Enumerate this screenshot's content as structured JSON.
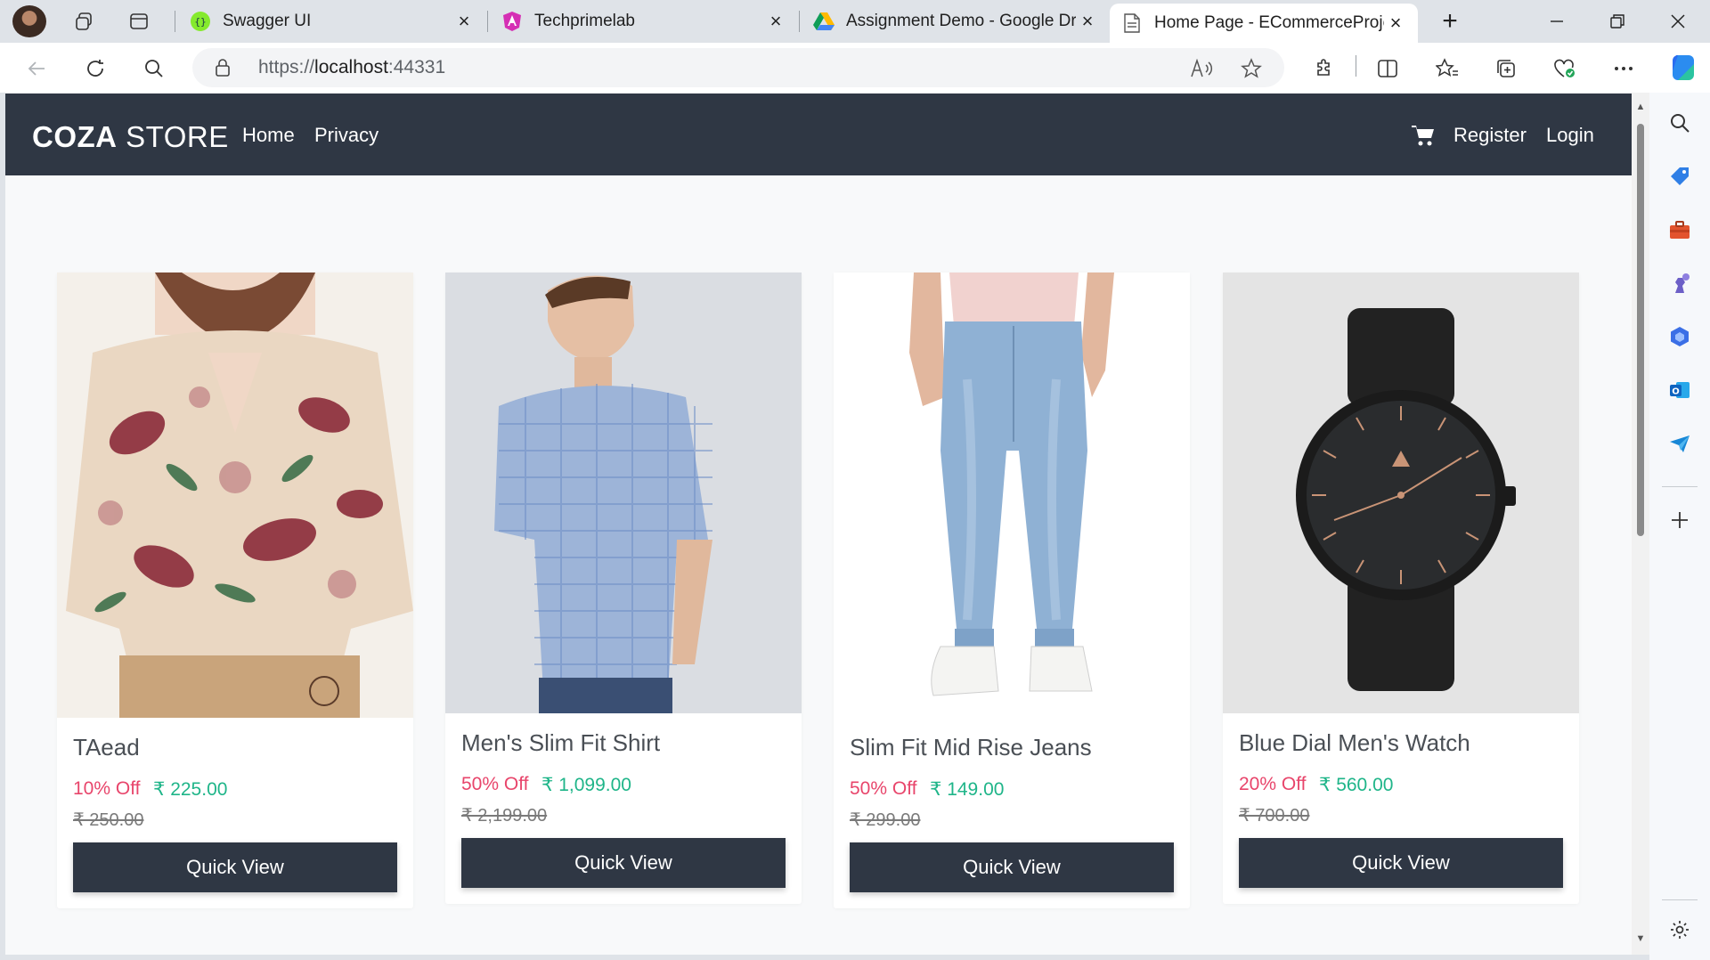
{
  "browser": {
    "tabs": [
      {
        "title": "Swagger UI",
        "icon": "swagger-icon"
      },
      {
        "title": "Techprimelab",
        "icon": "angular-icon"
      },
      {
        "title": "Assignment Demo - Google Dri",
        "icon": "google-drive-icon"
      },
      {
        "title": "Home Page - ECommerceProjec",
        "icon": "page-icon",
        "active": true
      }
    ],
    "close_glyph": "×",
    "new_tab_glyph": "+",
    "address": {
      "scheme": "https://",
      "host": "localhost",
      "port": ":44331"
    },
    "sidebar_icons": [
      "search-icon",
      "tag-icon",
      "toolbox-icon",
      "games-icon",
      "copilot-hex-icon",
      "outlook-icon",
      "send-icon",
      "add-icon",
      "settings-icon"
    ]
  },
  "site": {
    "brand_bold": "COZA",
    "brand_rest": " STORE",
    "nav": {
      "home": "Home",
      "privacy": "Privacy",
      "register": "Register",
      "login": "Login"
    }
  },
  "products": [
    {
      "name": "TAead",
      "discount": "10% Off",
      "price": "₹ 225.00",
      "old_price": "₹ 250.00",
      "button": "Quick View",
      "image": "floral-shirt"
    },
    {
      "name": "Men's Slim Fit Shirt",
      "discount": "50% Off",
      "price": "₹ 1,099.00",
      "old_price": "₹ 2,199.00",
      "button": "Quick View",
      "image": "checked-shirt"
    },
    {
      "name": "Slim Fit Mid Rise Jeans",
      "discount": "50% Off",
      "price": "₹ 149.00",
      "old_price": "₹ 299.00",
      "button": "Quick View",
      "image": "jeans"
    },
    {
      "name": "Blue Dial Men's Watch",
      "discount": "20% Off",
      "price": "₹ 560.00",
      "old_price": "₹ 700.00",
      "button": "Quick View",
      "image": "watch"
    }
  ],
  "colors": {
    "navbar": "#2f3744",
    "discount": "#e8456b",
    "price": "#1fb589",
    "button": "#2f3744",
    "page_bg": "#f8f9fa"
  }
}
